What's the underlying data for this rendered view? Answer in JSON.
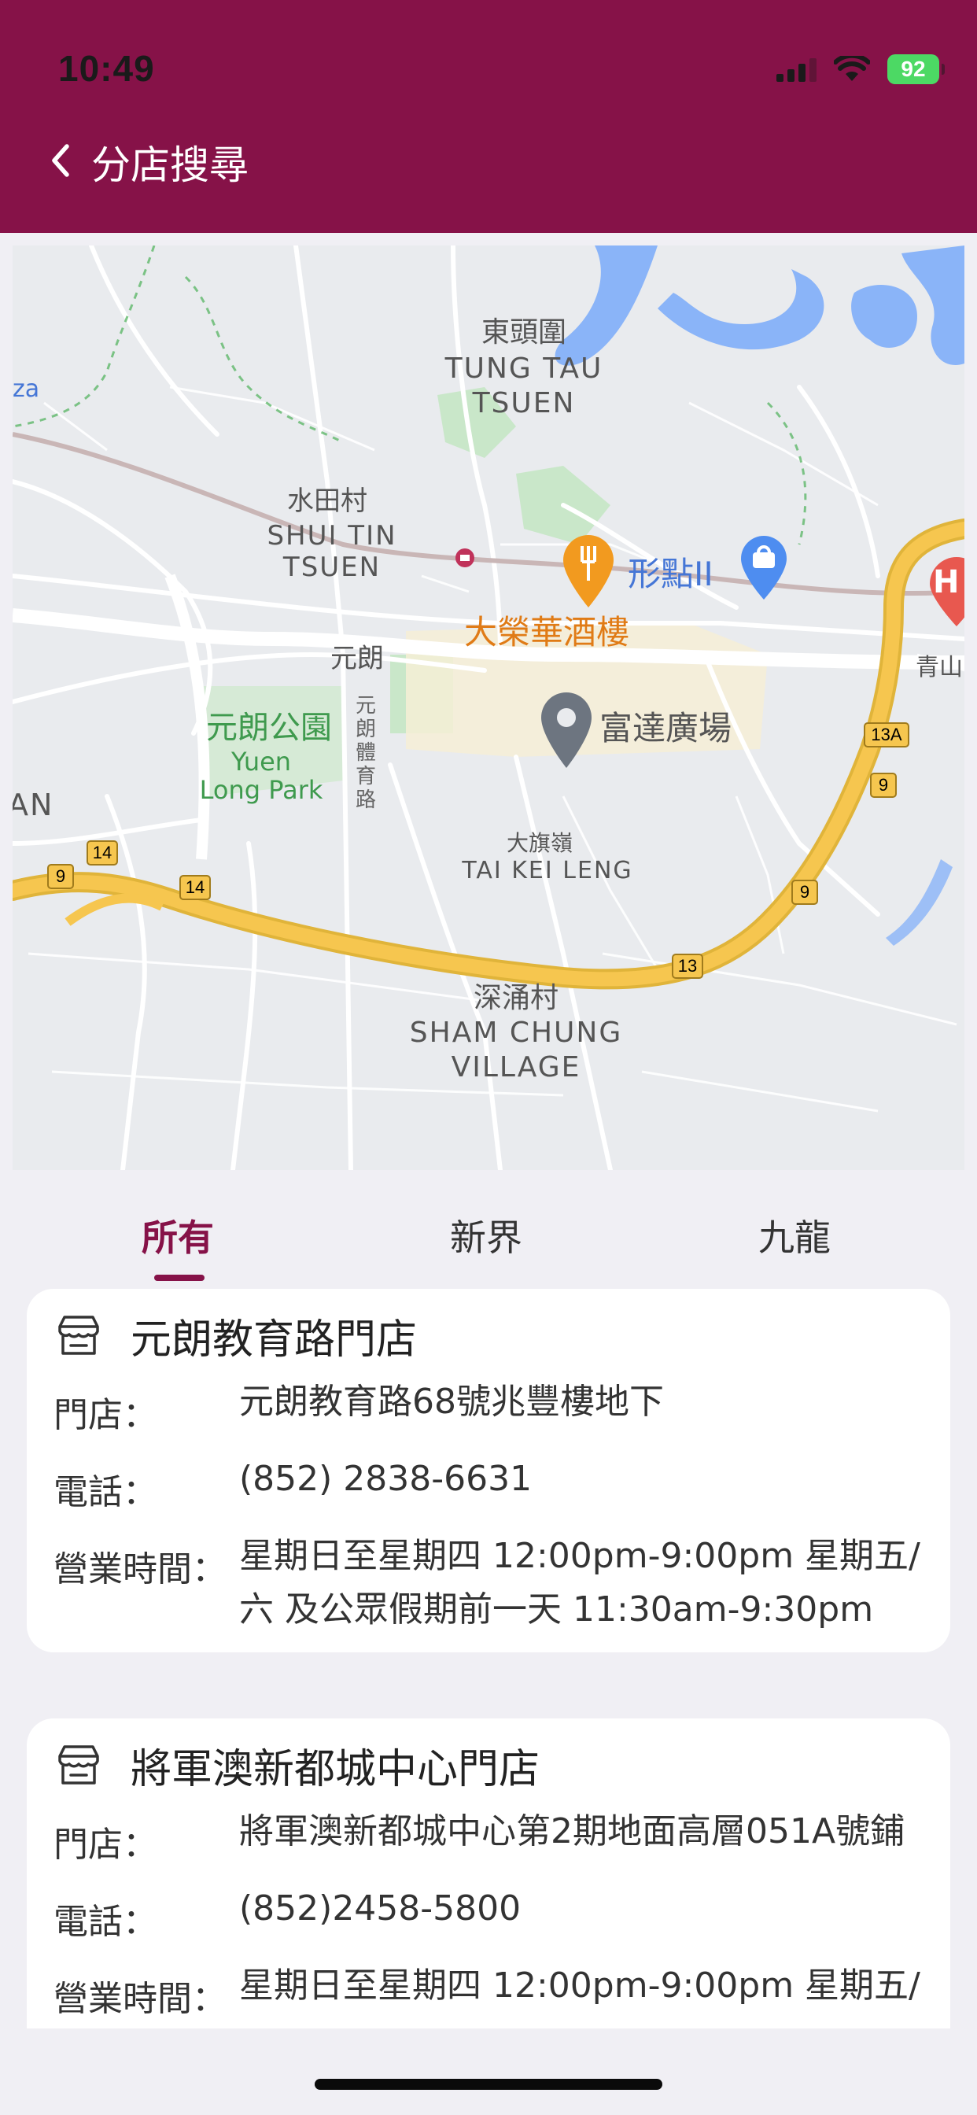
{
  "status_bar": {
    "time": "10:49",
    "battery": "92"
  },
  "header": {
    "title": "分店搜尋",
    "back_icon": "chevron-left-icon"
  },
  "map": {
    "labels": {
      "tung_tau_zh": "東頭圍",
      "tung_tau_en1": "TUNG TAU",
      "tung_tau_en2": "TSUEN",
      "shui_tin_zh": "水田村",
      "shui_tin_en1": "SHUI TIN",
      "shui_tin_en2": "TSUEN",
      "yuen": "元朗",
      "park_zh": "元朗公園",
      "park_en1": "Yuen",
      "park_en2": "Long Park",
      "yuk_road": "元朗體育路",
      "tai_kei_zh": "大旗嶺",
      "tai_kei_en": "TAI KEI LENG",
      "sham_chung_zh": "深涌村",
      "sham_chung_en1": "SHAM CHUNG",
      "sham_chung_en2": "VILLAGE",
      "restaurant": "大榮華酒樓",
      "mall2": "形點II",
      "fu_tat": "富達廣場",
      "ching_shan": "青山",
      "left_an": "AN",
      "left_za": "za",
      "hospital": "H"
    },
    "route_shields": [
      "14",
      "9",
      "14",
      "13",
      "9",
      "9",
      "13A"
    ]
  },
  "tabs": [
    {
      "label": "所有",
      "active": true
    },
    {
      "label": "新界",
      "active": false
    },
    {
      "label": "九龍",
      "active": false
    }
  ],
  "stores": [
    {
      "name": "元朗教育路門店",
      "address_label": "門店：",
      "address": "元朗教育路68號兆豐樓地下",
      "phone_label": "電話：",
      "phone": "(852) 2838-6631",
      "hours_label": "營業時間：",
      "hours_line1": "星期日至星期四 12:00pm-9:00pm   星期五/",
      "hours_line2": "六 及公眾假期前一天 11:30am-9:30pm"
    },
    {
      "name": "將軍澳新都城中心門店",
      "address_label": "門店：",
      "address": "將軍澳新都城中心第2期地面高層051A號鋪",
      "phone_label": "電話：",
      "phone": "(852)2458-5800",
      "hours_label": "營業時間：",
      "hours_line1": "星期日至星期四 12:00pm-9:00pm   星期五/"
    }
  ],
  "colors": {
    "brand": "#861248",
    "battery": "#4cd964",
    "map_highway": "#f6c64f",
    "map_water": "#8ab4f8",
    "map_park": "#b7dfb9"
  }
}
